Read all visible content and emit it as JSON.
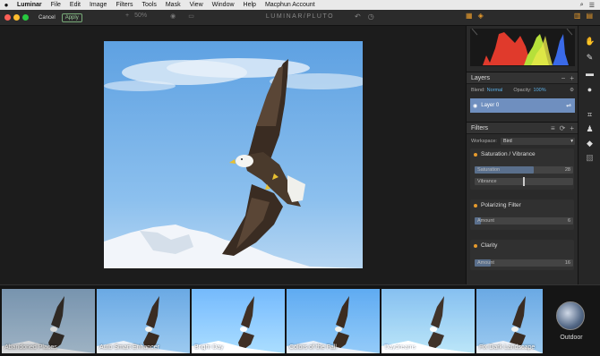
{
  "menubar": {
    "items": [
      "Luminar",
      "File",
      "Edit",
      "Image",
      "Filters",
      "Tools",
      "Mask",
      "View",
      "Window",
      "Help",
      "Macphun Account"
    ]
  },
  "toolbar": {
    "cancel_label": "Cancel",
    "apply_label": "Apply",
    "zoom": "50%",
    "brand": "LUMINAR/PLUTO"
  },
  "layers": {
    "title": "Layers",
    "blend_label": "Blend:",
    "blend_value": "Normal",
    "opacity_label": "Opacity:",
    "opacity_value": "100%",
    "layer_name": "Layer 0"
  },
  "filters": {
    "title": "Filters",
    "workspace_label": "Workspace:",
    "workspace_value": "Bird",
    "cards": [
      {
        "title": "Saturation / Vibrance",
        "sliders": [
          {
            "label": "Saturation",
            "value": "28",
            "fraction": 0.6
          },
          {
            "label": "Vibrance",
            "value": "",
            "fraction": 0.49
          }
        ]
      },
      {
        "title": "Polarizing Filter",
        "sliders": [
          {
            "label": "Amount",
            "value": "6",
            "fraction": 0.06
          }
        ]
      },
      {
        "title": "Clarity",
        "sliders": [
          {
            "label": "Amount",
            "value": "16",
            "fraction": 0.16
          }
        ]
      }
    ]
  },
  "presets": {
    "items": [
      "Abandoned Places",
      "Auto Smart Enhancer",
      "Bright Day",
      "Colors of the Fall",
      "Daydreams",
      "Fix Dark Landscape"
    ],
    "category": "Outdoor"
  },
  "colors": {
    "accent": "#e69a2c",
    "selection": "#6f8fbf",
    "blend_value": "#5bb0e8"
  }
}
